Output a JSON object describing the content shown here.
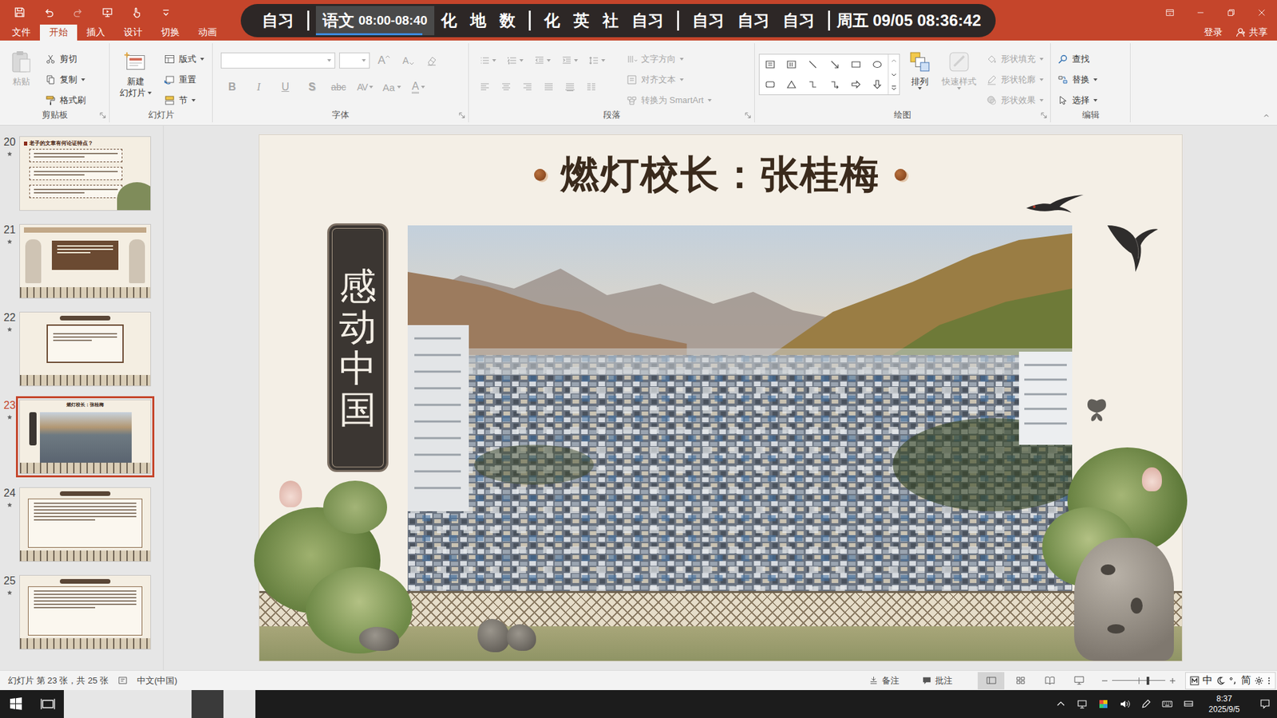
{
  "titleBar": {
    "login": "登录",
    "share": "共享",
    "redoDisabled": true
  },
  "schedule": {
    "groups": [
      [
        {
          "label": "自习",
          "selected": false
        }
      ],
      [
        {
          "label": "语文",
          "time": "08:00-08:40",
          "selected": true
        },
        {
          "label": "化",
          "selected": false
        },
        {
          "label": "地",
          "selected": false
        },
        {
          "label": "数",
          "selected": false
        }
      ],
      [
        {
          "label": "化",
          "selected": false
        },
        {
          "label": "英",
          "selected": false
        },
        {
          "label": "社",
          "selected": false
        },
        {
          "label": "自习",
          "selected": false
        }
      ],
      [
        {
          "label": "自习",
          "selected": false
        },
        {
          "label": "自习",
          "selected": false
        },
        {
          "label": "自习",
          "selected": false
        }
      ]
    ],
    "progress": 0.9,
    "clock": "周五 09/05 08:36:42"
  },
  "tabs": [
    {
      "label": "文件",
      "selected": false
    },
    {
      "label": "开始",
      "selected": true
    },
    {
      "label": "插入",
      "selected": false
    },
    {
      "label": "设计",
      "selected": false
    },
    {
      "label": "切换",
      "selected": false
    },
    {
      "label": "动画",
      "selected": false
    }
  ],
  "ribbon": {
    "clipboard": {
      "label": "剪贴板",
      "paste": {
        "label": "粘贴",
        "disabled": true
      },
      "items": [
        {
          "label": "剪切",
          "kind": "cut",
          "dropdown": false
        },
        {
          "label": "复制",
          "kind": "copy",
          "dropdown": true
        },
        {
          "label": "格式刷",
          "kind": "brush",
          "dropdown": false
        }
      ]
    },
    "slides": {
      "label": "幻灯片",
      "newSlide": [
        "新建",
        "幻灯片"
      ],
      "items": [
        {
          "label": "版式",
          "kind": "layout",
          "dropdown": true
        },
        {
          "label": "重置",
          "kind": "reset",
          "dropdown": false
        },
        {
          "label": "节",
          "kind": "section",
          "dropdown": true
        }
      ]
    },
    "font": {
      "label": "字体",
      "disabled": true,
      "sizeButtons": [
        {
          "label": "A",
          "kind": "grow"
        },
        {
          "label": "A",
          "kind": "shrink"
        }
      ],
      "formatButtons": [
        {
          "label": "B",
          "kind": "bold",
          "dropdown": false
        },
        {
          "label": "I",
          "kind": "italic",
          "dropdown": false
        },
        {
          "label": "U",
          "kind": "underline",
          "dropdown": false
        },
        {
          "label": "S",
          "kind": "shadow",
          "dropdown": false
        },
        {
          "label": "abc",
          "kind": "strike",
          "dropdown": false
        },
        {
          "label": "AV",
          "kind": "spacing",
          "dropdown": true
        },
        {
          "label": "Aa",
          "kind": "case",
          "dropdown": true
        },
        {
          "label": "A",
          "kind": "color",
          "dropdown": true
        }
      ]
    },
    "paragraph": {
      "label": "段落",
      "disabled": true,
      "items": [
        {
          "label": "文字方向",
          "kind": "direction"
        },
        {
          "label": "对齐文本",
          "kind": "align"
        },
        {
          "label": "转换为 SmartArt",
          "kind": "smartart"
        }
      ]
    },
    "drawing": {
      "label": "绘图",
      "arrange": "排列",
      "quickStyles": {
        "label": "快速样式",
        "disabled": true
      },
      "items": [
        {
          "label": "形状填充",
          "kind": "fill",
          "disabled": true
        },
        {
          "label": "形状轮廓",
          "kind": "outline",
          "disabled": true
        },
        {
          "label": "形状效果",
          "kind": "effects",
          "disabled": true
        }
      ]
    },
    "editing": {
      "label": "编辑",
      "items": [
        {
          "label": "查找",
          "kind": "find",
          "dropdown": false
        },
        {
          "label": "替换",
          "kind": "replace",
          "dropdown": true
        },
        {
          "label": "选择",
          "kind": "select",
          "dropdown": true
        }
      ]
    }
  },
  "thumbnails": [
    {
      "number": "20",
      "animated": true,
      "selected": false,
      "kind": "questions",
      "title": "老子的文章有何论证特点？"
    },
    {
      "number": "21",
      "animated": true,
      "selected": false,
      "kind": "figures"
    },
    {
      "number": "22",
      "animated": true,
      "selected": false,
      "kind": "prompt"
    },
    {
      "number": "23",
      "animated": true,
      "selected": true,
      "kind": "photo",
      "title": "燃灯校长：张桂梅"
    },
    {
      "number": "24",
      "animated": true,
      "selected": false,
      "kind": "essay"
    },
    {
      "number": "25",
      "animated": true,
      "selected": false,
      "kind": "essay"
    }
  ],
  "slide": {
    "title": "燃灯校长：张桂梅",
    "verticalLabel": "感动中国"
  },
  "statusBar": {
    "slideInfo": "幻灯片 第 23 张，共 25 张",
    "language": "中文(中国)",
    "notes": "备注",
    "comments": "批注",
    "views": [
      {
        "kind": "normal",
        "selected": true
      },
      {
        "kind": "sorter",
        "selected": false
      },
      {
        "kind": "reading",
        "selected": false
      },
      {
        "kind": "slideshow",
        "selected": false
      }
    ],
    "zoomLevel": 0.68,
    "ime": [
      "中",
      "简"
    ]
  },
  "taskbar": {
    "apps": [
      {
        "kind": "seewo",
        "active": false
      },
      {
        "kind": "green",
        "active": false
      },
      {
        "kind": "explorer",
        "active": false
      },
      {
        "kind": "edge",
        "active": false
      },
      {
        "kind": "qq",
        "active": true
      },
      {
        "kind": "powerpoint",
        "active": true
      }
    ],
    "time": "8:37",
    "date": "2025/9/5"
  }
}
